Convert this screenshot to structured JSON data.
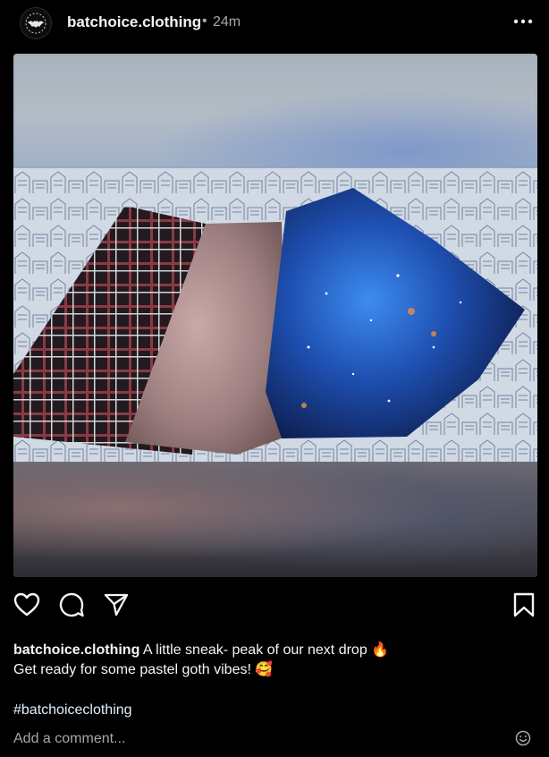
{
  "post": {
    "username": "batchoice.clothing",
    "separator": "•",
    "time_ago": "24m"
  },
  "icons": {
    "more": "more-horizontal-icon",
    "like": "heart-icon",
    "comment": "comment-bubble-icon",
    "share": "paper-plane-icon",
    "save": "bookmark-icon",
    "emoji": "smiley-icon"
  },
  "caption": {
    "username": "batchoice.clothing",
    "line1": "A little sneak- peak of our next drop 🔥",
    "line2": "Get ready for some pastel goth vibes! 🥰",
    "hashtag": "#batchoiceclothing"
  },
  "comment": {
    "placeholder": "Add a comment..."
  },
  "colors": {
    "background": "#000000",
    "text": "#f5f5f5",
    "muted": "#a8a8a8",
    "hashtag": "#e0f1ff"
  }
}
